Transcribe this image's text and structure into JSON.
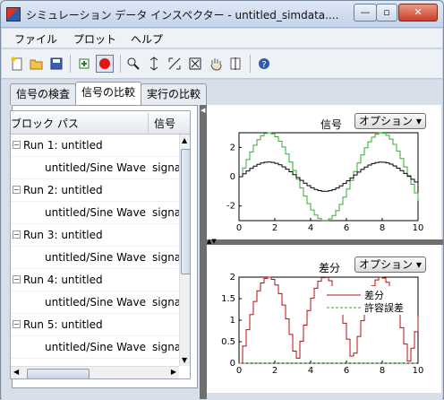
{
  "window": {
    "title": "シミュレーション データ インスペクター - untitled_simdata...."
  },
  "window_buttons": {
    "minimize": "—",
    "maximize": "▫",
    "close": "✕"
  },
  "menu": [
    "ファイル",
    "プロット",
    "ヘルプ"
  ],
  "toolbar_icons": [
    "new-file-icon",
    "open-folder-icon",
    "save-icon",
    "import-icon",
    "record-icon",
    "zoom-in-icon",
    "zoom-x-icon",
    "zoom-y-icon",
    "fit-to-view-icon",
    "pan-hand-icon",
    "data-cursor-icon",
    "help-icon"
  ],
  "tabs": [
    "信号の検査",
    "信号の比較",
    "実行の比較"
  ],
  "table": {
    "headers": [
      "ブロック パス",
      "信号"
    ],
    "runs": [
      {
        "run": "Run 1: untitled",
        "path": "untitled/Sine Wave",
        "signal": "signa"
      },
      {
        "run": "Run 2: untitled",
        "path": "untitled/Sine Wave",
        "signal": "signa"
      },
      {
        "run": "Run 3: untitled",
        "path": "untitled/Sine Wave",
        "signal": "signa"
      },
      {
        "run": "Run 4: untitled",
        "path": "untitled/Sine Wave",
        "signal": "signa"
      },
      {
        "run": "Run 5: untitled",
        "path": "untitled/Sine Wave",
        "signal": "signa"
      },
      {
        "run": "",
        "path": "untitled/Sine Wave",
        "signal": "signa"
      }
    ]
  },
  "top_plot": {
    "label": "信号",
    "option": "オプション ▾"
  },
  "bottom_plot": {
    "label": "差分",
    "option": "オプション ▾",
    "legend": [
      "差分",
      "許容誤差"
    ]
  },
  "colors": {
    "signal": "#000000",
    "compare": "#33aa33",
    "diff": "#b01010",
    "tolerance": "#33aa33"
  },
  "chart_data": [
    {
      "type": "line",
      "title": "信号",
      "xlim": [
        0,
        10
      ],
      "ylim": [
        -3,
        3
      ],
      "xticks": [
        0,
        2,
        4,
        6,
        8,
        10
      ],
      "yticks": [
        -2,
        0,
        2
      ],
      "series": [
        {
          "values": "y = sin(t) sampled step 0.2"
        },
        {
          "values": "y = 3*sin(t) sampled step 0.2"
        }
      ]
    },
    {
      "type": "line",
      "title": "差分",
      "xlim": [
        0,
        10
      ],
      "ylim": [
        0,
        2
      ],
      "xticks": [
        0,
        2,
        4,
        6,
        8,
        10
      ],
      "yticks": [
        0,
        0.5,
        1,
        1.5,
        2
      ],
      "series": [
        {
          "name": "差分",
          "values": "y = |2*sin(t)| step"
        },
        {
          "name": "許容誤差",
          "values": [
            0,
            0
          ]
        }
      ]
    }
  ]
}
